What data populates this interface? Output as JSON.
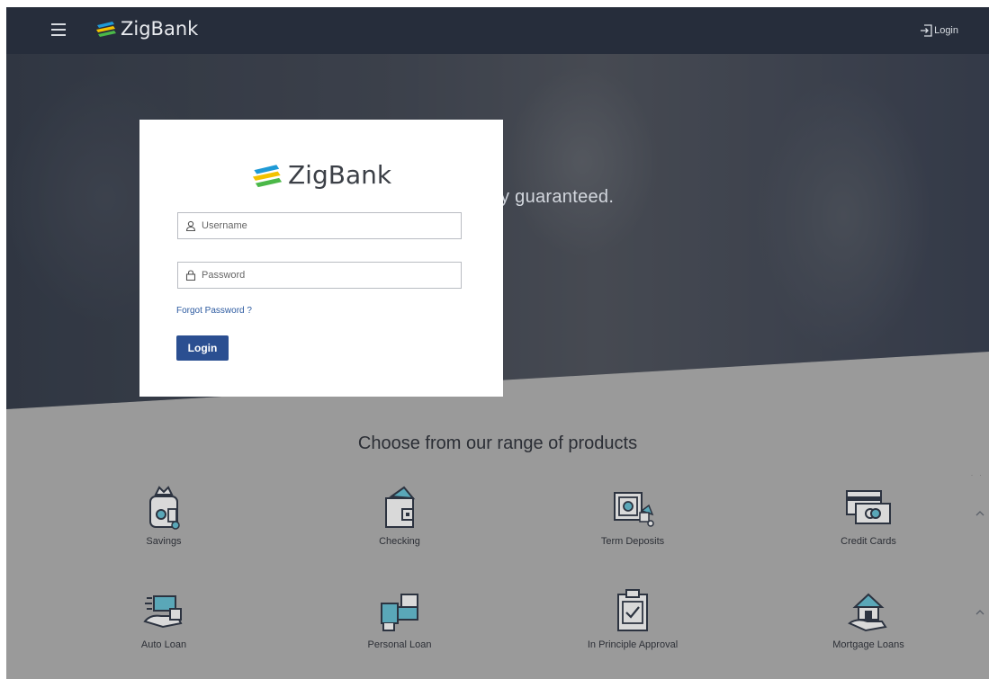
{
  "header": {
    "brand": "ZigBank",
    "login_label": "Login"
  },
  "hero": {
    "tagline": "urity guaranteed."
  },
  "login_card": {
    "brand": "ZigBank",
    "username_placeholder": "Username",
    "password_placeholder": "Password",
    "forgot_password": "Forgot Password ?",
    "login_button": "Login"
  },
  "products": {
    "title": "Choose from our range of products",
    "items": [
      {
        "label": "Savings",
        "icon": "savings-icon"
      },
      {
        "label": "Checking",
        "icon": "checking-icon"
      },
      {
        "label": "Term Deposits",
        "icon": "term-deposits-icon"
      },
      {
        "label": "Credit Cards",
        "icon": "credit-cards-icon"
      },
      {
        "label": "Auto Loan",
        "icon": "auto-loan-icon"
      },
      {
        "label": "Personal Loan",
        "icon": "personal-loan-icon"
      },
      {
        "label": "In Principle Approval",
        "icon": "in-principle-approval-icon"
      },
      {
        "label": "Mortgage Loans",
        "icon": "mortgage-loans-icon"
      }
    ]
  },
  "colors": {
    "header_bg": "#262d3b",
    "primary_button": "#2b4f91",
    "link": "#2c5aa0",
    "products_bg": "#9a9a9a"
  }
}
